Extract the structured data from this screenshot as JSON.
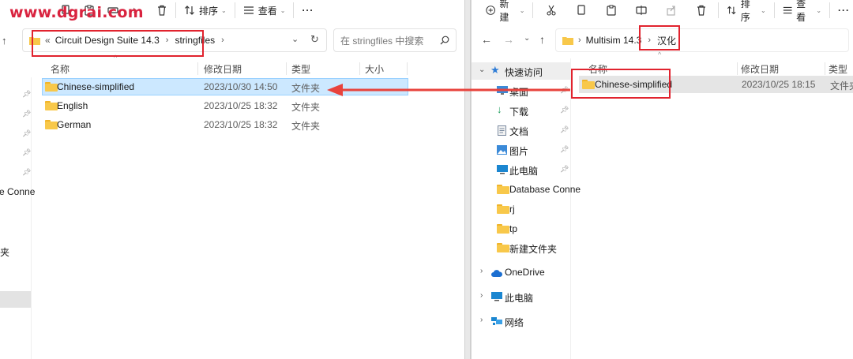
{
  "watermark": "www.dgrai.com",
  "colors": {
    "accent_red": "#e1232e",
    "selection": "#cce8ff",
    "folder": "#f8c84a"
  },
  "left": {
    "toolbar": {
      "sort_label": "排序",
      "view_label": "查看",
      "more_label": "···"
    },
    "breadcrumb": {
      "overflow": "«",
      "items": [
        "Circuit Design Suite 14.3",
        "stringfiles"
      ],
      "trail_chevron": "›"
    },
    "search": {
      "placeholder": "在 stringfiles 中搜索"
    },
    "columns": {
      "name": "名称",
      "date": "修改日期",
      "type": "类型",
      "size": "大小"
    },
    "rows": [
      {
        "name": "Chinese-simplified",
        "date": "2023/10/30 14:50",
        "type": "文件夹"
      },
      {
        "name": "English",
        "date": "2023/10/25 18:32",
        "type": "文件夹"
      },
      {
        "name": "German",
        "date": "2023/10/25 18:32",
        "type": "文件夹"
      }
    ],
    "nav_fragments": [
      "e Conne",
      "夹"
    ]
  },
  "right": {
    "toolbar": {
      "new_label": "新建",
      "sort_label": "排序",
      "view_label": "查看",
      "more_label": "···"
    },
    "breadcrumb": {
      "items": [
        "Multisim 14.3",
        "汉化"
      ]
    },
    "columns": {
      "name": "名称",
      "date": "修改日期",
      "type": "类型"
    },
    "rows": [
      {
        "name": "Chinese-simplified",
        "date": "2023/10/25 18:15",
        "type": "文件夹"
      }
    ],
    "nav": {
      "quick_access": "快速访问",
      "items": [
        "桌面",
        "下载",
        "文档",
        "图片",
        "此电脑",
        "Database Conne",
        "rj",
        "tp",
        "新建文件夹"
      ],
      "onedrive": "OneDrive",
      "this_pc": "此电脑",
      "network": "网络"
    }
  }
}
